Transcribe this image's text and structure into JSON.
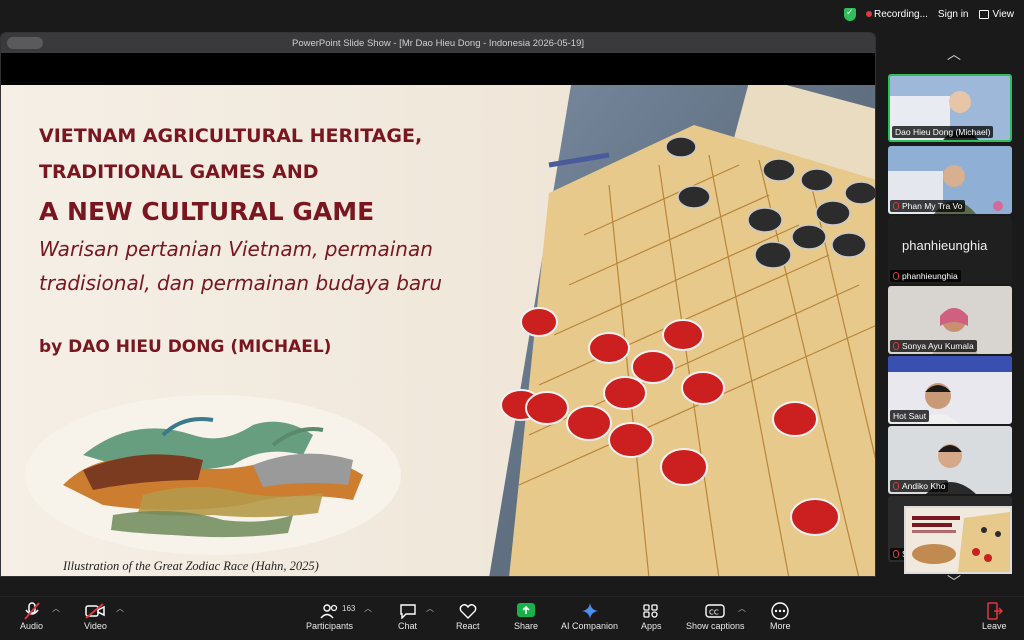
{
  "top": {
    "recording": "Recording...",
    "signin": "Sign in",
    "view": "View"
  },
  "share": {
    "title": "PowerPoint Slide Show - [Mr Dao Hieu Dong - Indonesia 2026-05-19]"
  },
  "slide": {
    "title1": "VIETNAM AGRICULTURAL HERITAGE,",
    "title2": "TRADITIONAL GAMES AND",
    "title3": "A NEW CULTURAL GAME",
    "subtitle1": "Warisan pertanian Vietnam, permainan",
    "subtitle2": "tradisional, dan permainan budaya baru",
    "byline": "by DAO HIEU DONG (MICHAEL)",
    "caption": "Illustration of the Great Zodiac Race (Hahn, 2025)"
  },
  "participants": [
    {
      "name": "Dao Hieu Dong (Michael)",
      "active": true
    },
    {
      "name": "Phan My Tra Vo",
      "active": false
    },
    {
      "name": "phanhieunghia",
      "big_name": "phanhieunghia",
      "active": false
    },
    {
      "name": "Sonya Ayu Kumala",
      "active": false
    },
    {
      "name": "Hot Saut",
      "active": false
    },
    {
      "name": "Andiko Kho",
      "active": false
    },
    {
      "name": "S",
      "active": false
    }
  ],
  "toolbar": {
    "audio": "Audio",
    "video": "Video",
    "participants": "Participants",
    "participants_count": "163",
    "chat": "Chat",
    "react": "React",
    "share": "Share",
    "ai": "AI Companion",
    "apps": "Apps",
    "captions": "Show captions",
    "more": "More",
    "leave": "Leave"
  },
  "colors": {
    "accent_green": "#2fbf5a",
    "title_maroon": "#7a1620",
    "share_green": "#19b14b",
    "leave_red": "#e0383e"
  }
}
